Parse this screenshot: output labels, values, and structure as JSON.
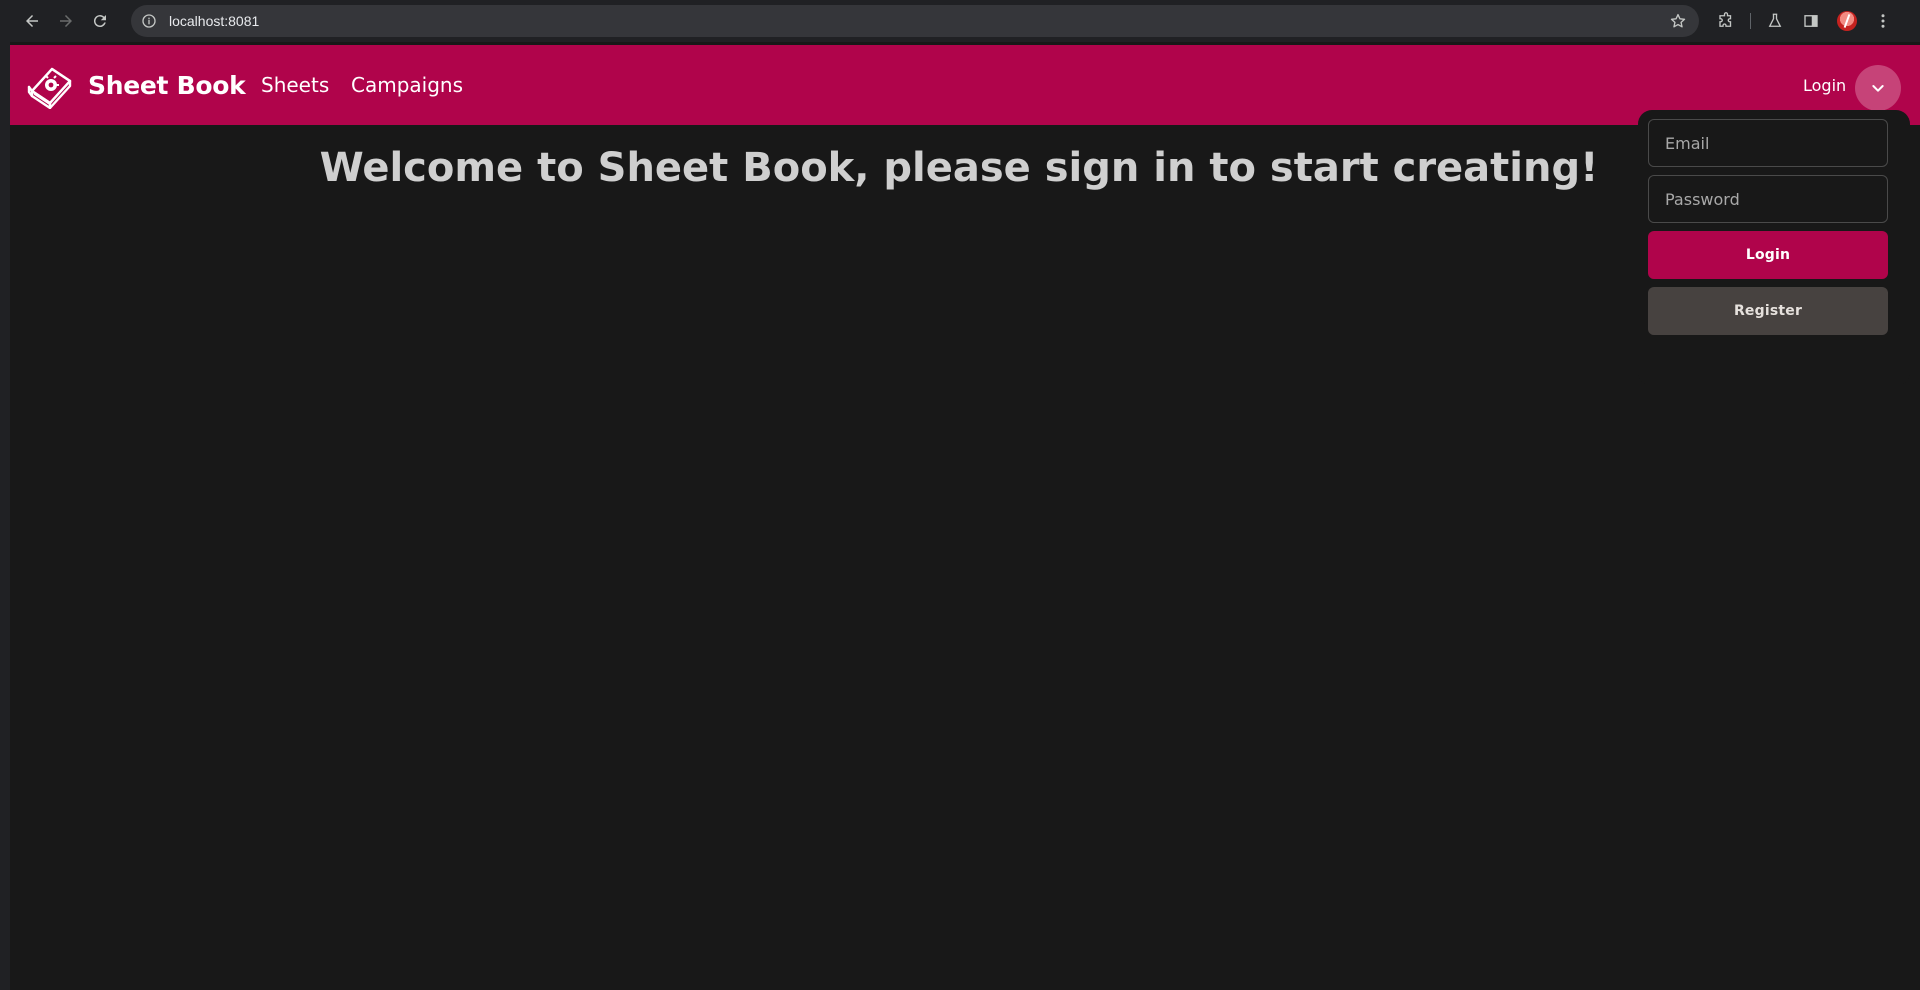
{
  "browser": {
    "url": "localhost:8081",
    "icons": {
      "back": "arrow-left-icon",
      "forward": "arrow-right-icon",
      "reload": "reload-icon",
      "site_info": "info-icon",
      "bookmark": "star-icon",
      "extensions": "puzzle-icon",
      "labs": "flask-icon",
      "side_panel": "side-panel-icon",
      "profile": "avatar",
      "menu": "kebab-menu-icon"
    }
  },
  "app": {
    "brand_name": "Sheet Book",
    "logo_icon": "book-logo-icon",
    "nav": {
      "sheets": "Sheets",
      "campaigns": "Campaigns"
    },
    "account": {
      "login_label": "Login",
      "toggle_icon": "chevron-down-icon"
    },
    "welcome_message": "Welcome to Sheet Book, please sign in to start creating!",
    "login_form": {
      "email_placeholder": "Email",
      "email_value": "",
      "password_placeholder": "Password",
      "password_value": "",
      "login_button": "Login",
      "register_button": "Register"
    },
    "colors": {
      "primary": "#b0044b",
      "toggle": "#c64378",
      "background": "#181818",
      "secondary_button": "#474240",
      "heading_text": "#cfcfcf"
    }
  }
}
